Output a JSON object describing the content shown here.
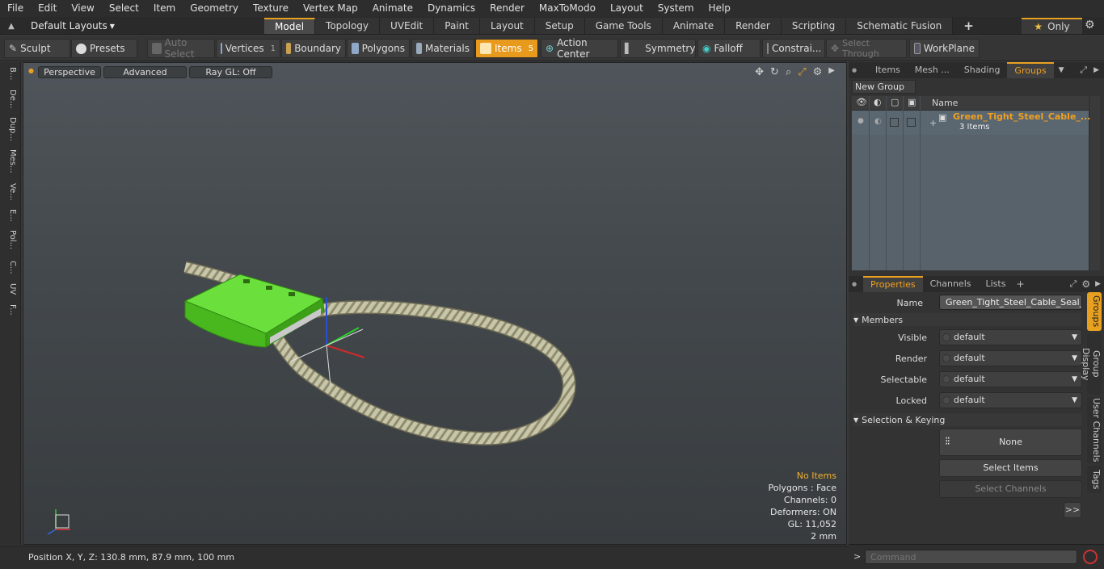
{
  "menu": [
    "File",
    "Edit",
    "View",
    "Select",
    "Item",
    "Geometry",
    "Texture",
    "Vertex Map",
    "Animate",
    "Dynamics",
    "Render",
    "MaxToModo",
    "Layout",
    "System",
    "Help"
  ],
  "layouts": {
    "label": "Default Layouts"
  },
  "tabs": [
    "Model",
    "Topology",
    "UVEdit",
    "Paint",
    "Layout",
    "Setup",
    "Game Tools",
    "Animate",
    "Render",
    "Scripting",
    "Schematic Fusion"
  ],
  "tabs_add": "+",
  "only_label": "Only",
  "toolbar": {
    "sculpt": "Sculpt",
    "presets": "Presets",
    "auto_select": "Auto Select",
    "vertices": "Vertices",
    "vertices_count": "1",
    "boundary": "Boundary",
    "polygons": "Polygons",
    "materials": "Materials",
    "items": "Items",
    "items_count": "5",
    "action_center": "Action Center",
    "symmetry": "Symmetry",
    "falloff": "Falloff",
    "constraints": "Constrai...",
    "select_through": "Select Through",
    "workplane": "WorkPlane"
  },
  "left_tabs": [
    "B...",
    "De...",
    "Dup...",
    "Mes...",
    "Ve...",
    "E...",
    "Pol...",
    "C...",
    "UV",
    "F..."
  ],
  "viewport": {
    "perspective": "Perspective",
    "advanced": "Advanced",
    "raygl": "Ray GL: Off",
    "stats": {
      "no_items": "No Items",
      "polygons": "Polygons : Face",
      "channels": "Channels: 0",
      "deformers": "Deformers: ON",
      "gl": "GL: 11,052",
      "unit": "2 mm"
    }
  },
  "statusbar": {
    "position": "Position X, Y, Z:   130.8 mm, 87.9 mm, 100 mm"
  },
  "groups_panel": {
    "tabs": [
      "Items",
      "Mesh ...",
      "Shading",
      "Groups"
    ],
    "new_group": "New Group",
    "col_name": "Name",
    "group_name": "Green_Tight_Steel_Cable_...",
    "group_items": "3 Items"
  },
  "properties": {
    "tabs": [
      "Properties",
      "Channels",
      "Lists"
    ],
    "name_label": "Name",
    "name_value": "Green_Tight_Steel_Cable_Seal_Lc",
    "members": "Members",
    "visible_label": "Visible",
    "visible_value": "default",
    "render_label": "Render",
    "render_value": "default",
    "selectable_label": "Selectable",
    "selectable_value": "default",
    "locked_label": "Locked",
    "locked_value": "default",
    "sel_keying": "Selection & Keying",
    "none_label": "None",
    "select_items": "Select Items",
    "select_channels": "Select Channels",
    "more": ">>"
  },
  "right_vtabs": [
    "Groups",
    "Group Display",
    "User Channels",
    "Tags"
  ],
  "command": {
    "placeholder": "Command"
  },
  "colors": {
    "accent": "#e8a020",
    "mesh_green": "#55d42a"
  }
}
